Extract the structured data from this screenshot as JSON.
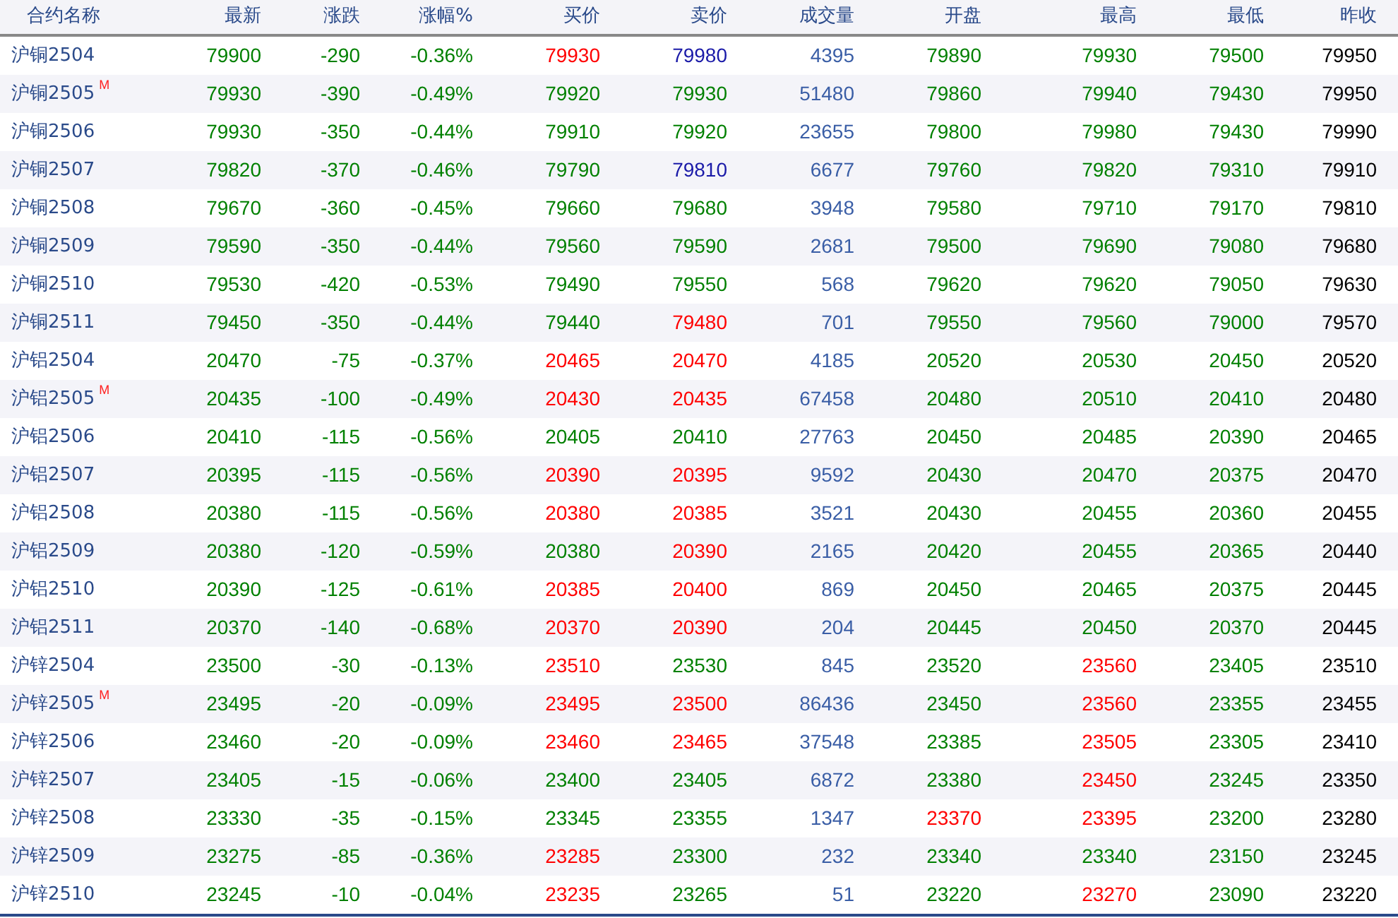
{
  "table": {
    "columns": [
      "合约名称",
      "最新",
      "涨跌",
      "涨幅%",
      "买价",
      "卖价",
      "成交量",
      "开盘",
      "最高",
      "最低",
      "昨收"
    ],
    "rows": [
      {
        "cells": [
          {
            "text": "沪铜2504",
            "color": "#2a4a8a"
          },
          {
            "text": "79900",
            "color": "#008000"
          },
          {
            "text": "-290",
            "color": "#008000"
          },
          {
            "text": "-0.36%",
            "color": "#008000"
          },
          {
            "text": "79930",
            "color": "#ff0000"
          },
          {
            "text": "79980",
            "color": "#1a1aa8"
          },
          {
            "text": "4395",
            "color": "#3a5ea6"
          },
          {
            "text": "79890",
            "color": "#008000"
          },
          {
            "text": "79930",
            "color": "#008000"
          },
          {
            "text": "79500",
            "color": "#008000"
          },
          {
            "text": "79950",
            "color": "#000000"
          }
        ]
      },
      {
        "cells": [
          {
            "text": "沪铜2505",
            "color": "#2a4a8a",
            "badge": "M"
          },
          {
            "text": "79930",
            "color": "#008000"
          },
          {
            "text": "-390",
            "color": "#008000"
          },
          {
            "text": "-0.49%",
            "color": "#008000"
          },
          {
            "text": "79920",
            "color": "#008000"
          },
          {
            "text": "79930",
            "color": "#008000"
          },
          {
            "text": "51480",
            "color": "#3a5ea6"
          },
          {
            "text": "79860",
            "color": "#008000"
          },
          {
            "text": "79940",
            "color": "#008000"
          },
          {
            "text": "79430",
            "color": "#008000"
          },
          {
            "text": "79950",
            "color": "#000000"
          }
        ]
      },
      {
        "cells": [
          {
            "text": "沪铜2506",
            "color": "#2a4a8a"
          },
          {
            "text": "79930",
            "color": "#008000"
          },
          {
            "text": "-350",
            "color": "#008000"
          },
          {
            "text": "-0.44%",
            "color": "#008000"
          },
          {
            "text": "79910",
            "color": "#008000"
          },
          {
            "text": "79920",
            "color": "#008000"
          },
          {
            "text": "23655",
            "color": "#3a5ea6"
          },
          {
            "text": "79800",
            "color": "#008000"
          },
          {
            "text": "79980",
            "color": "#008000"
          },
          {
            "text": "79430",
            "color": "#008000"
          },
          {
            "text": "79990",
            "color": "#000000"
          }
        ]
      },
      {
        "cells": [
          {
            "text": "沪铜2507",
            "color": "#2a4a8a"
          },
          {
            "text": "79820",
            "color": "#008000"
          },
          {
            "text": "-370",
            "color": "#008000"
          },
          {
            "text": "-0.46%",
            "color": "#008000"
          },
          {
            "text": "79790",
            "color": "#008000"
          },
          {
            "text": "79810",
            "color": "#1a1aa8"
          },
          {
            "text": "6677",
            "color": "#3a5ea6"
          },
          {
            "text": "79760",
            "color": "#008000"
          },
          {
            "text": "79820",
            "color": "#008000"
          },
          {
            "text": "79310",
            "color": "#008000"
          },
          {
            "text": "79910",
            "color": "#000000"
          }
        ]
      },
      {
        "cells": [
          {
            "text": "沪铜2508",
            "color": "#2a4a8a"
          },
          {
            "text": "79670",
            "color": "#008000"
          },
          {
            "text": "-360",
            "color": "#008000"
          },
          {
            "text": "-0.45%",
            "color": "#008000"
          },
          {
            "text": "79660",
            "color": "#008000"
          },
          {
            "text": "79680",
            "color": "#008000"
          },
          {
            "text": "3948",
            "color": "#3a5ea6"
          },
          {
            "text": "79580",
            "color": "#008000"
          },
          {
            "text": "79710",
            "color": "#008000"
          },
          {
            "text": "79170",
            "color": "#008000"
          },
          {
            "text": "79810",
            "color": "#000000"
          }
        ]
      },
      {
        "cells": [
          {
            "text": "沪铜2509",
            "color": "#2a4a8a"
          },
          {
            "text": "79590",
            "color": "#008000"
          },
          {
            "text": "-350",
            "color": "#008000"
          },
          {
            "text": "-0.44%",
            "color": "#008000"
          },
          {
            "text": "79560",
            "color": "#008000"
          },
          {
            "text": "79590",
            "color": "#008000"
          },
          {
            "text": "2681",
            "color": "#3a5ea6"
          },
          {
            "text": "79500",
            "color": "#008000"
          },
          {
            "text": "79690",
            "color": "#008000"
          },
          {
            "text": "79080",
            "color": "#008000"
          },
          {
            "text": "79680",
            "color": "#000000"
          }
        ]
      },
      {
        "cells": [
          {
            "text": "沪铜2510",
            "color": "#2a4a8a"
          },
          {
            "text": "79530",
            "color": "#008000"
          },
          {
            "text": "-420",
            "color": "#008000"
          },
          {
            "text": "-0.53%",
            "color": "#008000"
          },
          {
            "text": "79490",
            "color": "#008000"
          },
          {
            "text": "79550",
            "color": "#008000"
          },
          {
            "text": "568",
            "color": "#3a5ea6"
          },
          {
            "text": "79620",
            "color": "#008000"
          },
          {
            "text": "79620",
            "color": "#008000"
          },
          {
            "text": "79050",
            "color": "#008000"
          },
          {
            "text": "79630",
            "color": "#000000"
          }
        ]
      },
      {
        "cells": [
          {
            "text": "沪铜2511",
            "color": "#2a4a8a"
          },
          {
            "text": "79450",
            "color": "#008000"
          },
          {
            "text": "-350",
            "color": "#008000"
          },
          {
            "text": "-0.44%",
            "color": "#008000"
          },
          {
            "text": "79440",
            "color": "#008000"
          },
          {
            "text": "79480",
            "color": "#ff0000"
          },
          {
            "text": "701",
            "color": "#3a5ea6"
          },
          {
            "text": "79550",
            "color": "#008000"
          },
          {
            "text": "79560",
            "color": "#008000"
          },
          {
            "text": "79000",
            "color": "#008000"
          },
          {
            "text": "79570",
            "color": "#000000"
          }
        ]
      },
      {
        "cells": [
          {
            "text": "沪铝2504",
            "color": "#2a4a8a"
          },
          {
            "text": "20470",
            "color": "#008000"
          },
          {
            "text": "-75",
            "color": "#008000"
          },
          {
            "text": "-0.37%",
            "color": "#008000"
          },
          {
            "text": "20465",
            "color": "#ff0000"
          },
          {
            "text": "20470",
            "color": "#ff0000"
          },
          {
            "text": "4185",
            "color": "#3a5ea6"
          },
          {
            "text": "20520",
            "color": "#008000"
          },
          {
            "text": "20530",
            "color": "#008000"
          },
          {
            "text": "20450",
            "color": "#008000"
          },
          {
            "text": "20520",
            "color": "#000000"
          }
        ]
      },
      {
        "cells": [
          {
            "text": "沪铝2505",
            "color": "#2a4a8a",
            "badge": "M"
          },
          {
            "text": "20435",
            "color": "#008000"
          },
          {
            "text": "-100",
            "color": "#008000"
          },
          {
            "text": "-0.49%",
            "color": "#008000"
          },
          {
            "text": "20430",
            "color": "#ff0000"
          },
          {
            "text": "20435",
            "color": "#ff0000"
          },
          {
            "text": "67458",
            "color": "#3a5ea6"
          },
          {
            "text": "20480",
            "color": "#008000"
          },
          {
            "text": "20510",
            "color": "#008000"
          },
          {
            "text": "20410",
            "color": "#008000"
          },
          {
            "text": "20480",
            "color": "#000000"
          }
        ]
      },
      {
        "cells": [
          {
            "text": "沪铝2506",
            "color": "#2a4a8a"
          },
          {
            "text": "20410",
            "color": "#008000"
          },
          {
            "text": "-115",
            "color": "#008000"
          },
          {
            "text": "-0.56%",
            "color": "#008000"
          },
          {
            "text": "20405",
            "color": "#008000"
          },
          {
            "text": "20410",
            "color": "#008000"
          },
          {
            "text": "27763",
            "color": "#3a5ea6"
          },
          {
            "text": "20450",
            "color": "#008000"
          },
          {
            "text": "20485",
            "color": "#008000"
          },
          {
            "text": "20390",
            "color": "#008000"
          },
          {
            "text": "20465",
            "color": "#000000"
          }
        ]
      },
      {
        "cells": [
          {
            "text": "沪铝2507",
            "color": "#2a4a8a"
          },
          {
            "text": "20395",
            "color": "#008000"
          },
          {
            "text": "-115",
            "color": "#008000"
          },
          {
            "text": "-0.56%",
            "color": "#008000"
          },
          {
            "text": "20390",
            "color": "#ff0000"
          },
          {
            "text": "20395",
            "color": "#ff0000"
          },
          {
            "text": "9592",
            "color": "#3a5ea6"
          },
          {
            "text": "20430",
            "color": "#008000"
          },
          {
            "text": "20470",
            "color": "#008000"
          },
          {
            "text": "20375",
            "color": "#008000"
          },
          {
            "text": "20470",
            "color": "#000000"
          }
        ]
      },
      {
        "cells": [
          {
            "text": "沪铝2508",
            "color": "#2a4a8a"
          },
          {
            "text": "20380",
            "color": "#008000"
          },
          {
            "text": "-115",
            "color": "#008000"
          },
          {
            "text": "-0.56%",
            "color": "#008000"
          },
          {
            "text": "20380",
            "color": "#ff0000"
          },
          {
            "text": "20385",
            "color": "#ff0000"
          },
          {
            "text": "3521",
            "color": "#3a5ea6"
          },
          {
            "text": "20430",
            "color": "#008000"
          },
          {
            "text": "20455",
            "color": "#008000"
          },
          {
            "text": "20360",
            "color": "#008000"
          },
          {
            "text": "20455",
            "color": "#000000"
          }
        ]
      },
      {
        "cells": [
          {
            "text": "沪铝2509",
            "color": "#2a4a8a"
          },
          {
            "text": "20380",
            "color": "#008000"
          },
          {
            "text": "-120",
            "color": "#008000"
          },
          {
            "text": "-0.59%",
            "color": "#008000"
          },
          {
            "text": "20380",
            "color": "#008000"
          },
          {
            "text": "20390",
            "color": "#ff0000"
          },
          {
            "text": "2165",
            "color": "#3a5ea6"
          },
          {
            "text": "20420",
            "color": "#008000"
          },
          {
            "text": "20455",
            "color": "#008000"
          },
          {
            "text": "20365",
            "color": "#008000"
          },
          {
            "text": "20440",
            "color": "#000000"
          }
        ]
      },
      {
        "cells": [
          {
            "text": "沪铝2510",
            "color": "#2a4a8a"
          },
          {
            "text": "20390",
            "color": "#008000"
          },
          {
            "text": "-125",
            "color": "#008000"
          },
          {
            "text": "-0.61%",
            "color": "#008000"
          },
          {
            "text": "20385",
            "color": "#ff0000"
          },
          {
            "text": "20400",
            "color": "#ff0000"
          },
          {
            "text": "869",
            "color": "#3a5ea6"
          },
          {
            "text": "20450",
            "color": "#008000"
          },
          {
            "text": "20465",
            "color": "#008000"
          },
          {
            "text": "20375",
            "color": "#008000"
          },
          {
            "text": "20445",
            "color": "#000000"
          }
        ]
      },
      {
        "cells": [
          {
            "text": "沪铝2511",
            "color": "#2a4a8a"
          },
          {
            "text": "20370",
            "color": "#008000"
          },
          {
            "text": "-140",
            "color": "#008000"
          },
          {
            "text": "-0.68%",
            "color": "#008000"
          },
          {
            "text": "20370",
            "color": "#ff0000"
          },
          {
            "text": "20390",
            "color": "#ff0000"
          },
          {
            "text": "204",
            "color": "#3a5ea6"
          },
          {
            "text": "20445",
            "color": "#008000"
          },
          {
            "text": "20450",
            "color": "#008000"
          },
          {
            "text": "20370",
            "color": "#008000"
          },
          {
            "text": "20445",
            "color": "#000000"
          }
        ]
      },
      {
        "cells": [
          {
            "text": "沪锌2504",
            "color": "#2a4a8a"
          },
          {
            "text": "23500",
            "color": "#008000"
          },
          {
            "text": "-30",
            "color": "#008000"
          },
          {
            "text": "-0.13%",
            "color": "#008000"
          },
          {
            "text": "23510",
            "color": "#ff0000"
          },
          {
            "text": "23530",
            "color": "#008000"
          },
          {
            "text": "845",
            "color": "#3a5ea6"
          },
          {
            "text": "23520",
            "color": "#008000"
          },
          {
            "text": "23560",
            "color": "#ff0000"
          },
          {
            "text": "23405",
            "color": "#008000"
          },
          {
            "text": "23510",
            "color": "#000000"
          }
        ]
      },
      {
        "cells": [
          {
            "text": "沪锌2505",
            "color": "#2a4a8a",
            "badge": "M"
          },
          {
            "text": "23495",
            "color": "#008000"
          },
          {
            "text": "-20",
            "color": "#008000"
          },
          {
            "text": "-0.09%",
            "color": "#008000"
          },
          {
            "text": "23495",
            "color": "#ff0000"
          },
          {
            "text": "23500",
            "color": "#ff0000"
          },
          {
            "text": "86436",
            "color": "#3a5ea6"
          },
          {
            "text": "23450",
            "color": "#008000"
          },
          {
            "text": "23560",
            "color": "#ff0000"
          },
          {
            "text": "23355",
            "color": "#008000"
          },
          {
            "text": "23455",
            "color": "#000000"
          }
        ]
      },
      {
        "cells": [
          {
            "text": "沪锌2506",
            "color": "#2a4a8a"
          },
          {
            "text": "23460",
            "color": "#008000"
          },
          {
            "text": "-20",
            "color": "#008000"
          },
          {
            "text": "-0.09%",
            "color": "#008000"
          },
          {
            "text": "23460",
            "color": "#ff0000"
          },
          {
            "text": "23465",
            "color": "#ff0000"
          },
          {
            "text": "37548",
            "color": "#3a5ea6"
          },
          {
            "text": "23385",
            "color": "#008000"
          },
          {
            "text": "23505",
            "color": "#ff0000"
          },
          {
            "text": "23305",
            "color": "#008000"
          },
          {
            "text": "23410",
            "color": "#000000"
          }
        ]
      },
      {
        "cells": [
          {
            "text": "沪锌2507",
            "color": "#2a4a8a"
          },
          {
            "text": "23405",
            "color": "#008000"
          },
          {
            "text": "-15",
            "color": "#008000"
          },
          {
            "text": "-0.06%",
            "color": "#008000"
          },
          {
            "text": "23400",
            "color": "#008000"
          },
          {
            "text": "23405",
            "color": "#008000"
          },
          {
            "text": "6872",
            "color": "#3a5ea6"
          },
          {
            "text": "23380",
            "color": "#008000"
          },
          {
            "text": "23450",
            "color": "#ff0000"
          },
          {
            "text": "23245",
            "color": "#008000"
          },
          {
            "text": "23350",
            "color": "#000000"
          }
        ]
      },
      {
        "cells": [
          {
            "text": "沪锌2508",
            "color": "#2a4a8a"
          },
          {
            "text": "23330",
            "color": "#008000"
          },
          {
            "text": "-35",
            "color": "#008000"
          },
          {
            "text": "-0.15%",
            "color": "#008000"
          },
          {
            "text": "23345",
            "color": "#008000"
          },
          {
            "text": "23355",
            "color": "#008000"
          },
          {
            "text": "1347",
            "color": "#3a5ea6"
          },
          {
            "text": "23370",
            "color": "#ff0000"
          },
          {
            "text": "23395",
            "color": "#ff0000"
          },
          {
            "text": "23200",
            "color": "#008000"
          },
          {
            "text": "23280",
            "color": "#000000"
          }
        ]
      },
      {
        "cells": [
          {
            "text": "沪锌2509",
            "color": "#2a4a8a"
          },
          {
            "text": "23275",
            "color": "#008000"
          },
          {
            "text": "-85",
            "color": "#008000"
          },
          {
            "text": "-0.36%",
            "color": "#008000"
          },
          {
            "text": "23285",
            "color": "#ff0000"
          },
          {
            "text": "23300",
            "color": "#008000"
          },
          {
            "text": "232",
            "color": "#3a5ea6"
          },
          {
            "text": "23340",
            "color": "#008000"
          },
          {
            "text": "23340",
            "color": "#008000"
          },
          {
            "text": "23150",
            "color": "#008000"
          },
          {
            "text": "23245",
            "color": "#000000"
          }
        ]
      },
      {
        "cells": [
          {
            "text": "沪锌2510",
            "color": "#2a4a8a"
          },
          {
            "text": "23245",
            "color": "#008000"
          },
          {
            "text": "-10",
            "color": "#008000"
          },
          {
            "text": "-0.04%",
            "color": "#008000"
          },
          {
            "text": "23235",
            "color": "#ff0000"
          },
          {
            "text": "23265",
            "color": "#008000"
          },
          {
            "text": "51",
            "color": "#3a5ea6"
          },
          {
            "text": "23220",
            "color": "#008000"
          },
          {
            "text": "23270",
            "color": "#ff0000"
          },
          {
            "text": "23090",
            "color": "#008000"
          },
          {
            "text": "23220",
            "color": "#000000"
          }
        ]
      }
    ]
  }
}
